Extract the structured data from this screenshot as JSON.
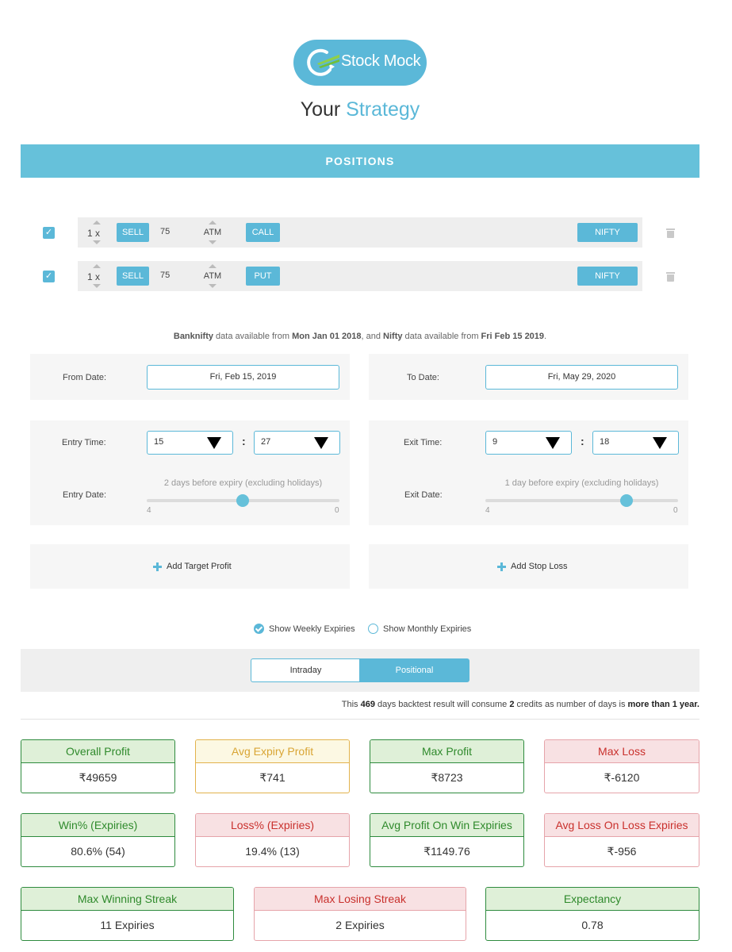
{
  "brand": {
    "name": "Stock Mock",
    "primary_color": "#5bb8d8"
  },
  "title": {
    "prefix": "Your",
    "accent": "Strategy"
  },
  "positions_header": "POSITIONS",
  "positions": [
    {
      "checked": true,
      "qty": "1 x",
      "action": "SELL",
      "lot": "75",
      "strike": "ATM",
      "option_type": "CALL",
      "instrument": "NIFTY"
    },
    {
      "checked": true,
      "qty": "1 x",
      "action": "SELL",
      "lot": "75",
      "strike": "ATM",
      "option_type": "PUT",
      "instrument": "NIFTY"
    }
  ],
  "availability": {
    "bn_name": "Banknifty",
    "t1": " data available from ",
    "bn_date": "Mon Jan 01 2018",
    "t2": ", and ",
    "nifty_name": "Nifty",
    "t3": " data available from ",
    "nifty_date": "Fri Feb 15 2019",
    "t4": "."
  },
  "from_date": {
    "label": "From Date:",
    "value": "Fri, Feb 15, 2019"
  },
  "to_date": {
    "label": "To Date:",
    "value": "Fri, May 29, 2020"
  },
  "entry": {
    "time_label": "Entry Time:",
    "hour": "15",
    "minute": "27",
    "date_label": "Entry Date:",
    "caption": "2 days before expiry (excluding holidays)",
    "slider_min": "4",
    "slider_max": "0",
    "slider_value": 2
  },
  "exit": {
    "time_label": "Exit Time:",
    "hour": "9",
    "minute": "18",
    "date_label": "Exit Date:",
    "caption": "1 day before expiry (excluding holidays)",
    "slider_min": "4",
    "slider_max": "0",
    "slider_value": 1
  },
  "add_target_profit": "Add Target Profit",
  "add_stop_loss": "Add Stop Loss",
  "expiry_options": {
    "weekly": "Show Weekly Expiries",
    "monthly": "Show Monthly Expiries",
    "selected": "weekly"
  },
  "mode": {
    "intraday": "Intraday",
    "positional": "Positional",
    "selected": "Positional"
  },
  "credits_note": {
    "t1": "This ",
    "days": "469",
    "t2": " days backtest result will consume ",
    "credits": "2",
    "t3": " credits as number of days is ",
    "cond": "more than 1 year."
  },
  "stats_row1": [
    {
      "label": "Overall Profit",
      "value": "₹49659",
      "tone": "green"
    },
    {
      "label": "Avg Expiry Profit",
      "value": "₹741",
      "tone": "yellow"
    },
    {
      "label": "Max Profit",
      "value": "₹8723",
      "tone": "green"
    },
    {
      "label": "Max Loss",
      "value": "₹-6120",
      "tone": "red"
    }
  ],
  "stats_row2": [
    {
      "label": "Win% (Expiries)",
      "value": "80.6% (54)",
      "tone": "green"
    },
    {
      "label": "Loss% (Expiries)",
      "value": "19.4% (13)",
      "tone": "red"
    },
    {
      "label": "Avg Profit On Win Expiries",
      "value": "₹1149.76",
      "tone": "green"
    },
    {
      "label": "Avg Loss On Loss Expiries",
      "value": "₹-956",
      "tone": "red"
    }
  ],
  "stats_row3": [
    {
      "label": "Max Winning Streak",
      "value": "11 Expiries",
      "tone": "green"
    },
    {
      "label": "Max Losing Streak",
      "value": "2 Expiries",
      "tone": "red"
    },
    {
      "label": "Expectancy",
      "value": "0.78",
      "tone": "green"
    }
  ]
}
